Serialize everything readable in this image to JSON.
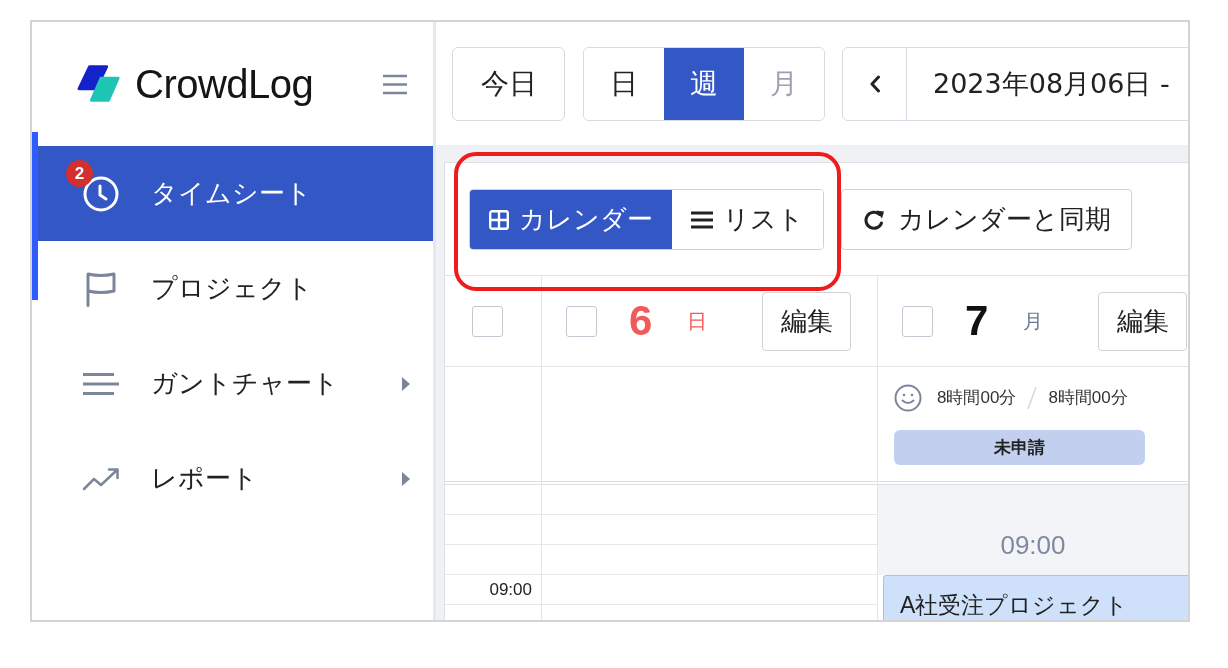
{
  "sidebar": {
    "logo": "CrowdLog",
    "items": [
      {
        "label": "タイムシート",
        "selected": true,
        "badge": "2",
        "has_submenu": false
      },
      {
        "label": "プロジェクト",
        "selected": false,
        "has_submenu": false
      },
      {
        "label": "ガントチャート",
        "selected": false,
        "has_submenu": true
      },
      {
        "label": "レポート",
        "selected": false,
        "has_submenu": true
      }
    ]
  },
  "toolbar": {
    "today_button": "今日",
    "range_tabs": [
      {
        "label": "日",
        "selected": false,
        "disabled": false
      },
      {
        "label": "週",
        "selected": true,
        "disabled": false
      },
      {
        "label": "月",
        "selected": false,
        "disabled": true
      }
    ],
    "date_range": "2023年08月06日 -"
  },
  "view_tabs": [
    {
      "label": "カレンダー",
      "selected": true
    },
    {
      "label": "リスト",
      "selected": false
    }
  ],
  "sync_button": "カレンダーと同期",
  "calendar": {
    "select_all": {
      "checked": false
    },
    "time_axis": [
      "09:00"
    ],
    "days": [
      {
        "kind": "sunday",
        "date": "6",
        "weekday": "日",
        "checked": false,
        "edit_button": "編集"
      },
      {
        "kind": "weekday",
        "date": "7",
        "weekday": "月",
        "checked": false,
        "edit_button": "編集",
        "actual_hours": "8時間00分",
        "planned_hours": "8時間00分",
        "status": "未申請",
        "work_start": "09:00",
        "entries": [
          {
            "title": "A社受注プロジェクト"
          }
        ]
      }
    ]
  }
}
